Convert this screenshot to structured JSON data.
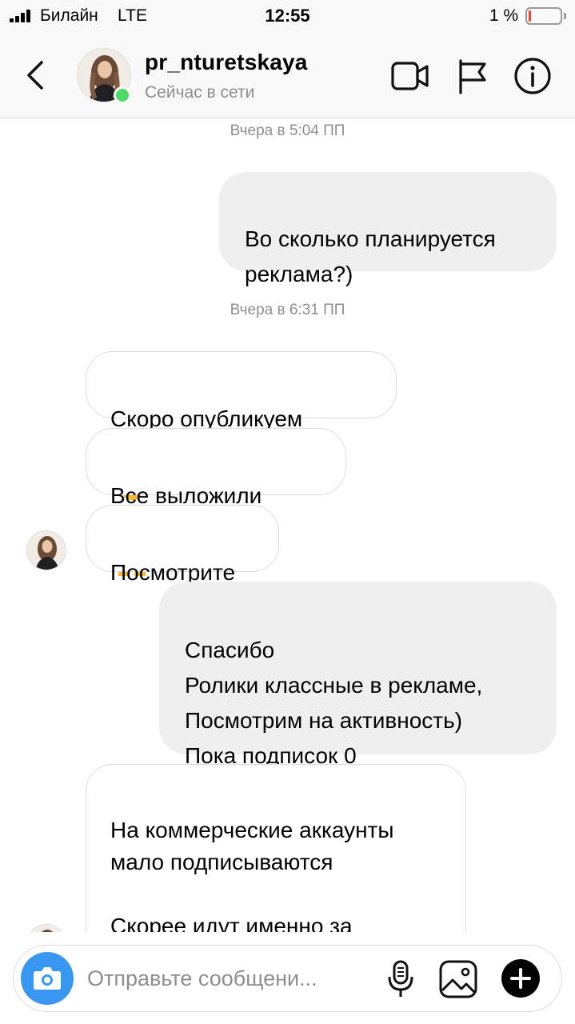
{
  "status_bar": {
    "carrier": "Билайн",
    "network": "LTE",
    "time": "12:55",
    "battery_text": "1 %",
    "battery_level": 0.01,
    "signal_bars": 4
  },
  "header": {
    "username": "pr_nturetskaya",
    "presence": "Сейчас в сети",
    "online": true,
    "icons": [
      "back-chevron-icon",
      "video-camera-icon",
      "flag-icon",
      "info-icon"
    ]
  },
  "chat": {
    "timestamps": [
      "Вчера в 5:04 ПП",
      "Вчера в 6:31 ПП"
    ],
    "messages": [
      {
        "from": "me",
        "text": "Во сколько планируется\nреклама?)"
      },
      {
        "from": "them",
        "text": "Скоро опубликуем",
        "emoji": "ok-hand-icon"
      },
      {
        "from": "them",
        "text": "Все выложили",
        "emoji": "raising-hands-icon"
      },
      {
        "from": "them",
        "text": "Посмотрите"
      },
      {
        "from": "me",
        "text": "Спасибо\nРолики классные в рекламе,\nПосмотрим на активность)\nПока подписок 0"
      },
      {
        "from": "them",
        "text": "На коммерческие аккаунты\nмало подписываются\n\nСкорее идут именно за\nпокупкой"
      }
    ]
  },
  "composer": {
    "placeholder": "Отправьте сообщени...",
    "icons": [
      "camera-icon",
      "microphone-icon",
      "gallery-icon",
      "plus-icon"
    ],
    "accent_color": "#3897f0"
  },
  "colors": {
    "online": "#4cd964",
    "bubble_outgoing": "#efefef",
    "bubble_incoming_border": "#dbdbdb",
    "muted_text": "#8e8e8e"
  }
}
